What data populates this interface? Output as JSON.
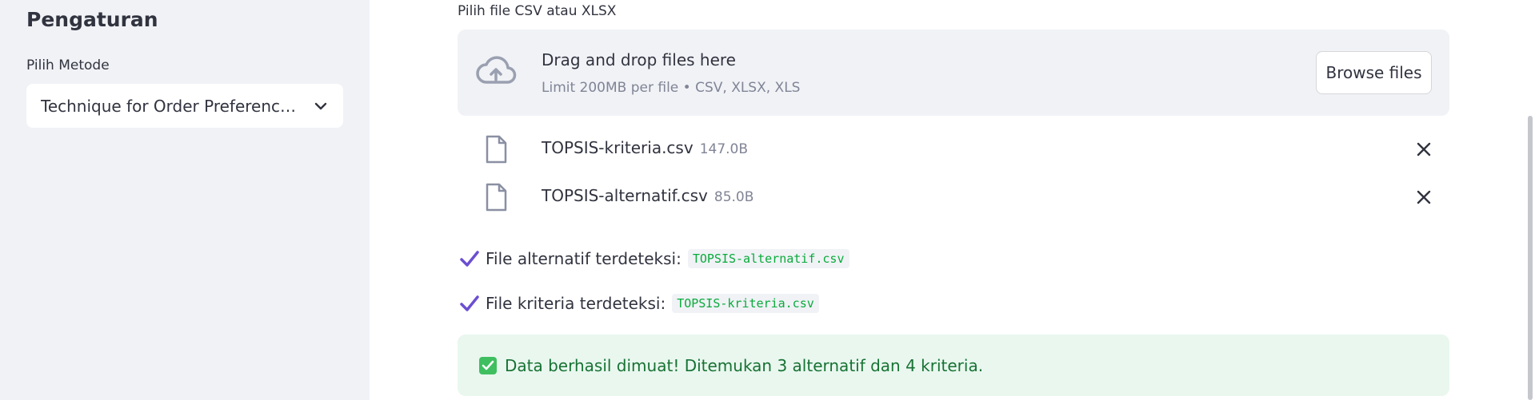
{
  "sidebar": {
    "title": "Pengaturan",
    "method_label": "Pilih Metode",
    "method_value": "Technique for Order Preference by Similarity to Ideal Solution"
  },
  "uploader": {
    "label": "Pilih file CSV atau XLSX",
    "drop_title": "Drag and drop files here",
    "limit_text": "Limit 200MB per file • CSV, XLSX, XLS",
    "browse_label": "Browse files",
    "files": [
      {
        "name": "TOPSIS-kriteria.csv",
        "size": "147.0B"
      },
      {
        "name": "TOPSIS-alternatif.csv",
        "size": "85.0B"
      }
    ]
  },
  "detections": [
    {
      "text": "File alternatif terdeteksi:",
      "file": "TOPSIS-alternatif.csv"
    },
    {
      "text": "File kriteria terdeteksi:",
      "file": "TOPSIS-kriteria.csv"
    }
  ],
  "success": {
    "message": "Data berhasil dimuat! Ditemukan 3 alternatif dan 4 kriteria."
  },
  "colors": {
    "sidebar_bg": "#f0f2f6",
    "accent_check": "#6c4fd1",
    "success_bg": "#e9f7ef",
    "success_text": "#177233",
    "code_text": "#09ab3b"
  },
  "icons": {
    "upload": "cloud-upload-icon",
    "file": "file-icon",
    "remove": "close-icon",
    "detected": "check-icon",
    "success": "check-box-icon",
    "dropdown": "chevron-down-icon"
  }
}
